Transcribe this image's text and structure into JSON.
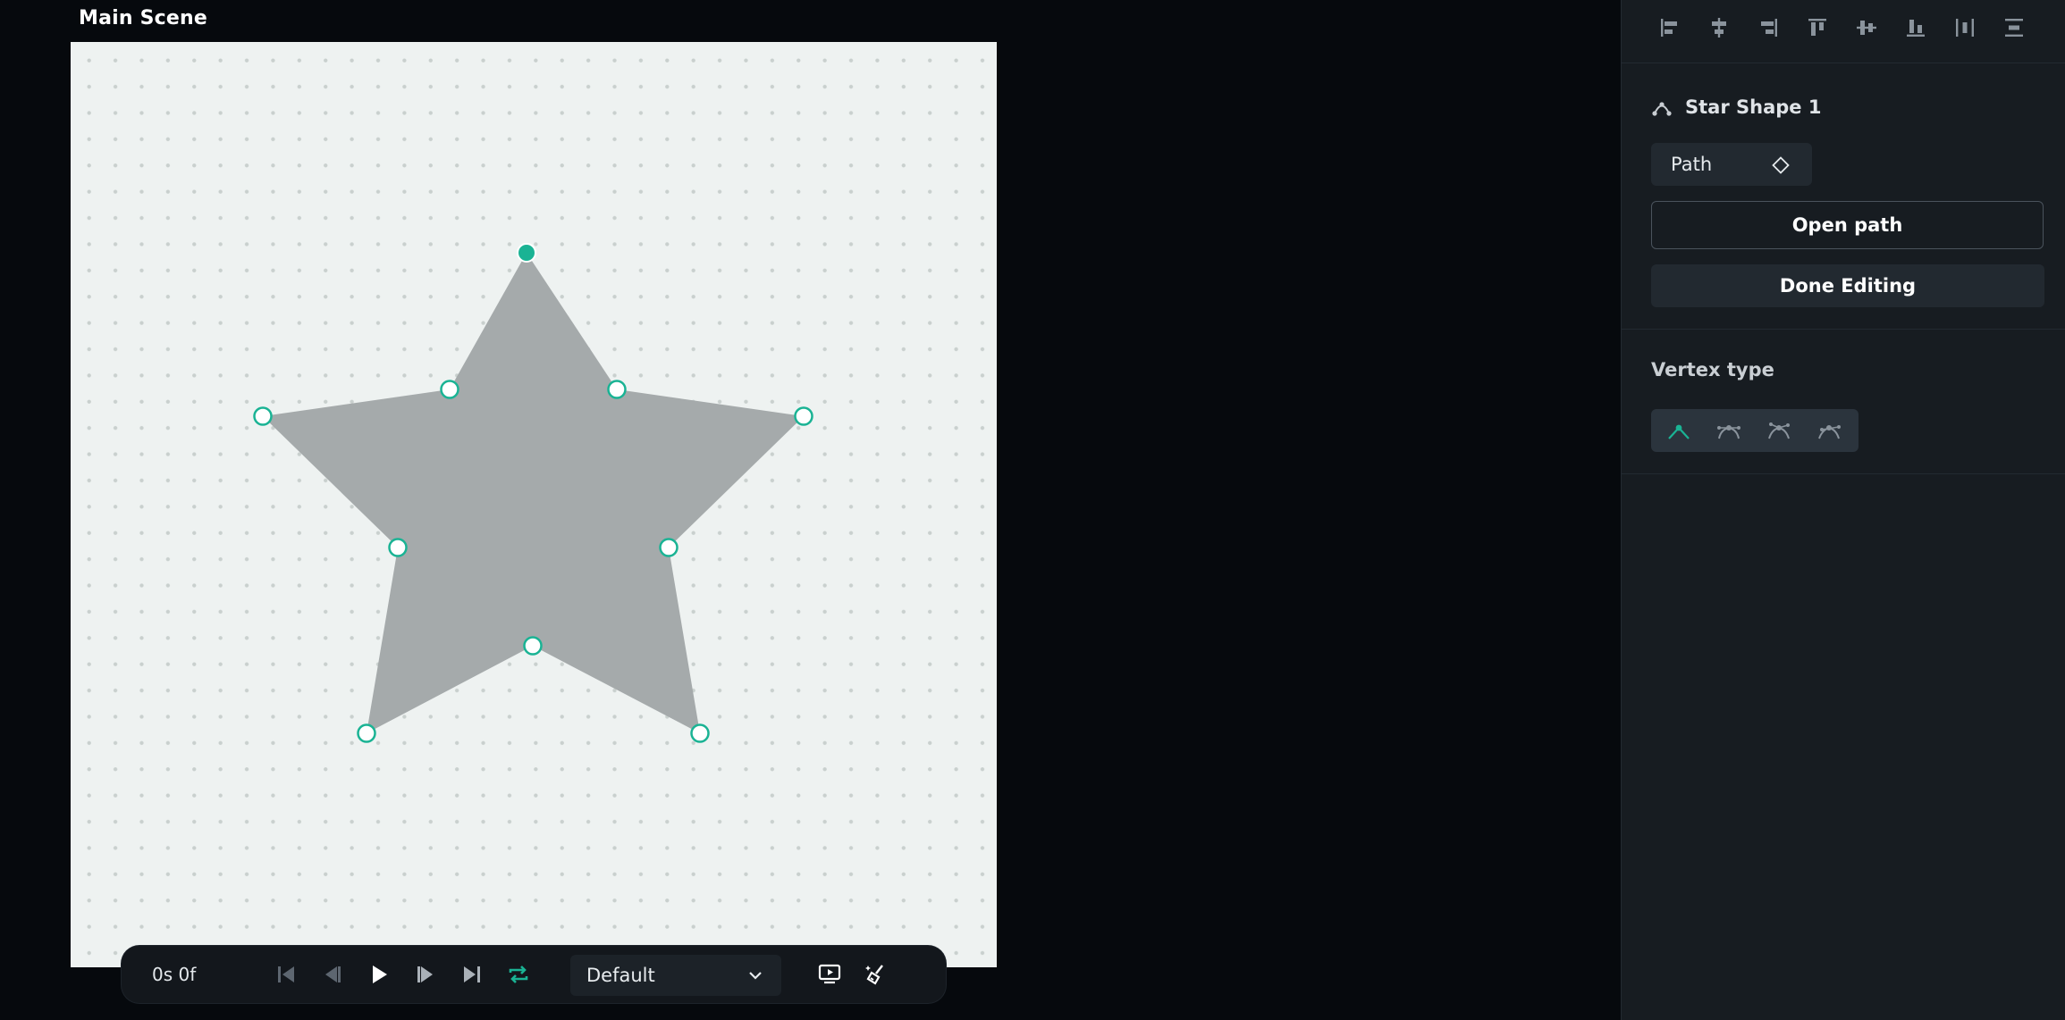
{
  "scene": {
    "title": "Main Scene"
  },
  "canvas": {
    "background": "#eef2f1",
    "shape_fill": "#a5aaab",
    "accent": "#1ab394"
  },
  "playback": {
    "time": "0s 0f",
    "animation_select": "Default",
    "controls": [
      "skip-to-start-icon",
      "step-back-icon",
      "play-icon",
      "step-forward-icon",
      "skip-to-end-icon",
      "loop-icon"
    ],
    "loop_active_color": "#1ab394"
  },
  "toolbar": {
    "align_tools": [
      "align-left-icon",
      "align-horizontal-center-icon",
      "align-right-icon",
      "align-top-icon",
      "align-vertical-center-icon",
      "align-bottom-icon",
      "distribute-horizontal-icon",
      "distribute-vertical-icon"
    ]
  },
  "inspector": {
    "object_name": "Star Shape 1",
    "path_label": "Path",
    "open_path_label": "Open path",
    "done_editing_label": "Done Editing",
    "vertex_type_heading": "Vertex type",
    "vertex_types": [
      "straight-vertex-icon",
      "mirrored-vertex-icon",
      "detached-vertex-icon",
      "asymmetric-vertex-icon"
    ],
    "selected_vertex_type": "straight-vertex-icon"
  }
}
